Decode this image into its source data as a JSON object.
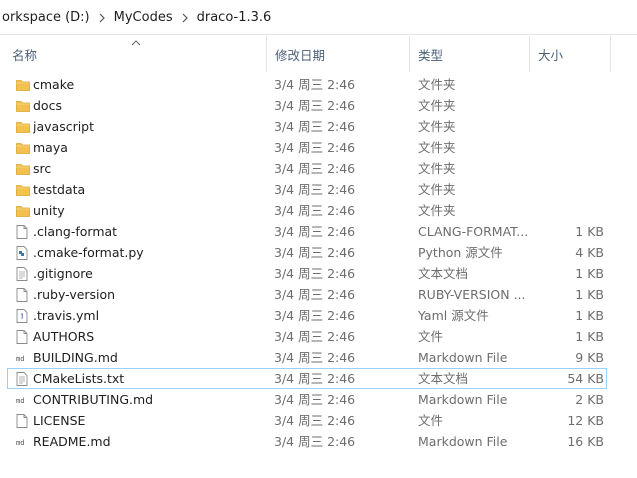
{
  "breadcrumb": [
    "orkspace (D:)",
    "MyCodes",
    "draco-1.3.6"
  ],
  "columns": {
    "name": "名称",
    "date": "修改日期",
    "type": "类型",
    "size": "大小"
  },
  "files": [
    {
      "name": "cmake",
      "date": "3/4 周三 2:46",
      "type": "文件夹",
      "size": "",
      "icon": "folder-icon"
    },
    {
      "name": "docs",
      "date": "3/4 周三 2:46",
      "type": "文件夹",
      "size": "",
      "icon": "folder-icon"
    },
    {
      "name": "javascript",
      "date": "3/4 周三 2:46",
      "type": "文件夹",
      "size": "",
      "icon": "folder-icon"
    },
    {
      "name": "maya",
      "date": "3/4 周三 2:46",
      "type": "文件夹",
      "size": "",
      "icon": "folder-icon"
    },
    {
      "name": "src",
      "date": "3/4 周三 2:46",
      "type": "文件夹",
      "size": "",
      "icon": "folder-icon"
    },
    {
      "name": "testdata",
      "date": "3/4 周三 2:46",
      "type": "文件夹",
      "size": "",
      "icon": "folder-icon"
    },
    {
      "name": "unity",
      "date": "3/4 周三 2:46",
      "type": "文件夹",
      "size": "",
      "icon": "folder-icon"
    },
    {
      "name": ".clang-format",
      "date": "3/4 周三 2:46",
      "type": "CLANG-FORMAT...",
      "size": "1 KB",
      "icon": "file-icon"
    },
    {
      "name": ".cmake-format.py",
      "date": "3/4 周三 2:46",
      "type": "Python 源文件",
      "size": "4 KB",
      "icon": "python-file-icon"
    },
    {
      "name": ".gitignore",
      "date": "3/4 周三 2:46",
      "type": "文本文档",
      "size": "1 KB",
      "icon": "text-file-icon"
    },
    {
      "name": ".ruby-version",
      "date": "3/4 周三 2:46",
      "type": "RUBY-VERSION ...",
      "size": "1 KB",
      "icon": "file-icon"
    },
    {
      "name": ".travis.yml",
      "date": "3/4 周三 2:46",
      "type": "Yaml 源文件",
      "size": "1 KB",
      "icon": "yaml-file-icon"
    },
    {
      "name": "AUTHORS",
      "date": "3/4 周三 2:46",
      "type": "文件",
      "size": "1 KB",
      "icon": "file-icon"
    },
    {
      "name": "BUILDING.md",
      "date": "3/4 周三 2:46",
      "type": "Markdown File",
      "size": "9 KB",
      "icon": "markdown-file-icon"
    },
    {
      "name": "CMakeLists.txt",
      "date": "3/4 周三 2:46",
      "type": "文本文档",
      "size": "54 KB",
      "icon": "text-file-icon"
    },
    {
      "name": "CONTRIBUTING.md",
      "date": "3/4 周三 2:46",
      "type": "Markdown File",
      "size": "2 KB",
      "icon": "markdown-file-icon"
    },
    {
      "name": "LICENSE",
      "date": "3/4 周三 2:46",
      "type": "文件",
      "size": "12 KB",
      "icon": "file-icon"
    },
    {
      "name": "README.md",
      "date": "3/4 周三 2:46",
      "type": "Markdown File",
      "size": "16 KB",
      "icon": "markdown-file-icon"
    }
  ],
  "selected_file": "CMakeLists.txt",
  "colors": {
    "folder": "#f2c14e",
    "selection_border": "#99d1ff",
    "header_text": "#4c607a"
  }
}
